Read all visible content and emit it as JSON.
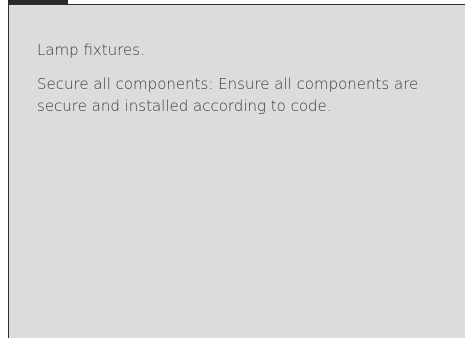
{
  "card": {
    "title_text": "Lamp fixtures.",
    "body_text": "Secure all components: Ensure all components are secure and installed according to code."
  }
}
